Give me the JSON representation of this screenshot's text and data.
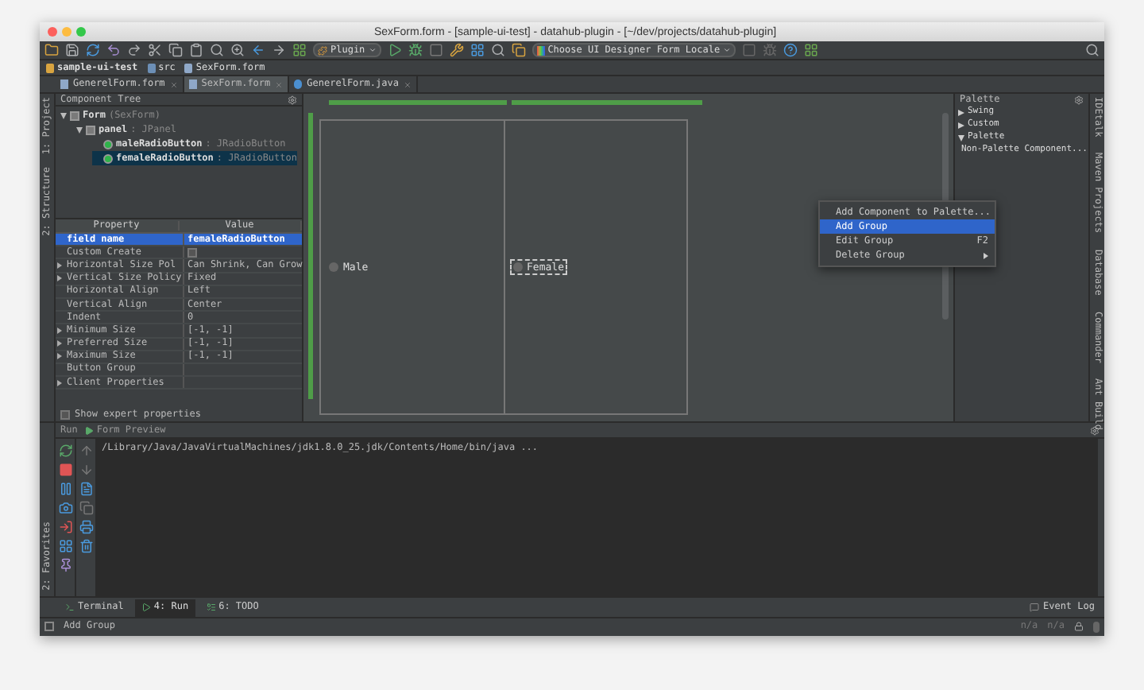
{
  "window": {
    "title": "SexForm.form - [sample-ui-test] - datahub-plugin - [~/dev/projects/datahub-plugin]"
  },
  "toolbar": {
    "run_config": "Plugin",
    "locale": "Choose UI Designer Form Locale"
  },
  "breadcrumbs": [
    {
      "label": "sample-ui-test",
      "kind": "project"
    },
    {
      "label": "src",
      "kind": "folder"
    },
    {
      "label": "SexForm.form",
      "kind": "file"
    }
  ],
  "tabs": [
    {
      "label": "GenerelForm.form",
      "selected": false,
      "kind": "form"
    },
    {
      "label": "SexForm.form",
      "selected": true,
      "kind": "form"
    },
    {
      "label": "GenerelForm.java",
      "selected": false,
      "kind": "java"
    }
  ],
  "left_stripe": [
    "1: Project",
    "2: Structure"
  ],
  "component_tree": {
    "title": "Component Tree",
    "items": [
      {
        "name": "Form",
        "type": "(SexForm)",
        "selected": false,
        "expanded": true,
        "kind": "form",
        "children": [
          {
            "name": "panel",
            "type": ": JPanel",
            "selected": false,
            "expanded": true,
            "kind": "panel",
            "children": [
              {
                "name": "maleRadioButton",
                "type": ": JRadioButton",
                "selected": false,
                "kind": "radio"
              },
              {
                "name": "femaleRadioButton",
                "type": ": JRadioButton",
                "selected": true,
                "kind": "radio"
              }
            ]
          }
        ]
      }
    ]
  },
  "properties": {
    "columns": [
      "Property",
      "Value"
    ],
    "rows": [
      {
        "name": "field name",
        "value": "femaleRadioButton",
        "selected": true,
        "expandable": false,
        "kind": "text"
      },
      {
        "name": "Custom Create",
        "checked": false,
        "selected": false,
        "expandable": false,
        "kind": "checkbox"
      },
      {
        "name": "Horizontal Size Pol",
        "value": "Can Shrink, Can Grow",
        "selected": false,
        "expandable": true,
        "kind": "text"
      },
      {
        "name": "Vertical Size Policy",
        "value": "Fixed",
        "selected": false,
        "expandable": true,
        "kind": "text"
      },
      {
        "name": "Horizontal Align",
        "value": "Left",
        "selected": false,
        "expandable": false,
        "kind": "text"
      },
      {
        "name": "Vertical Align",
        "value": "Center",
        "selected": false,
        "expandable": false,
        "kind": "text"
      },
      {
        "name": "Indent",
        "value": "0",
        "selected": false,
        "expandable": false,
        "kind": "text"
      },
      {
        "name": "Minimum Size",
        "value": "[-1, -1]",
        "selected": false,
        "expandable": true,
        "kind": "text"
      },
      {
        "name": "Preferred Size",
        "value": "[-1, -1]",
        "selected": false,
        "expandable": true,
        "kind": "text"
      },
      {
        "name": "Maximum Size",
        "value": "[-1, -1]",
        "selected": false,
        "expandable": true,
        "kind": "text"
      },
      {
        "name": "Button Group",
        "value": "",
        "selected": false,
        "expandable": false,
        "kind": "text"
      },
      {
        "name": "Client Properties",
        "value": "",
        "selected": false,
        "expandable": true,
        "kind": "text"
      }
    ]
  },
  "show_expert_properties": {
    "label": "Show expert properties",
    "checked": false
  },
  "designer": {
    "radios": [
      {
        "label": "Male",
        "checked": false,
        "selected": false
      },
      {
        "label": "Female",
        "checked": false,
        "selected": true
      }
    ]
  },
  "context_menu": [
    {
      "label": "Add Component to Palette...",
      "selected": false
    },
    {
      "label": "Add Group",
      "selected": true
    },
    {
      "label": "Edit Group",
      "shortcut": "F2",
      "selected": false
    },
    {
      "label": "Delete Group",
      "submenu": true,
      "selected": false
    }
  ],
  "palette": {
    "title": "Palette",
    "items": [
      {
        "label": "Swing",
        "expanded": false
      },
      {
        "label": "Custom",
        "expanded": false
      },
      {
        "label": "Palette",
        "expanded": true,
        "children": [
          {
            "label": "Non-Palette Component..."
          }
        ]
      }
    ]
  },
  "right_stripe": [
    "IDEtalk",
    "Maven Projects",
    "Database",
    "Commander",
    "Ant Build"
  ],
  "run_panel": {
    "title": "Run",
    "config": "Form Preview",
    "console": [
      "/Library/Java/JavaVirtualMachines/jdk1.8.0_25.jdk/Contents/Home/bin/java ..."
    ],
    "favorites": "2: Favorites"
  },
  "bottom_tabs": [
    {
      "label": "Terminal",
      "selected": false,
      "kind": "terminal"
    },
    {
      "label": "4: Run",
      "selected": true,
      "kind": "run"
    },
    {
      "label": "6: TODO",
      "selected": false,
      "kind": "todo"
    }
  ],
  "event_log": "Event Log",
  "status_bar": {
    "message": "Add Group",
    "fields": [
      "n/a",
      "n/a"
    ]
  }
}
